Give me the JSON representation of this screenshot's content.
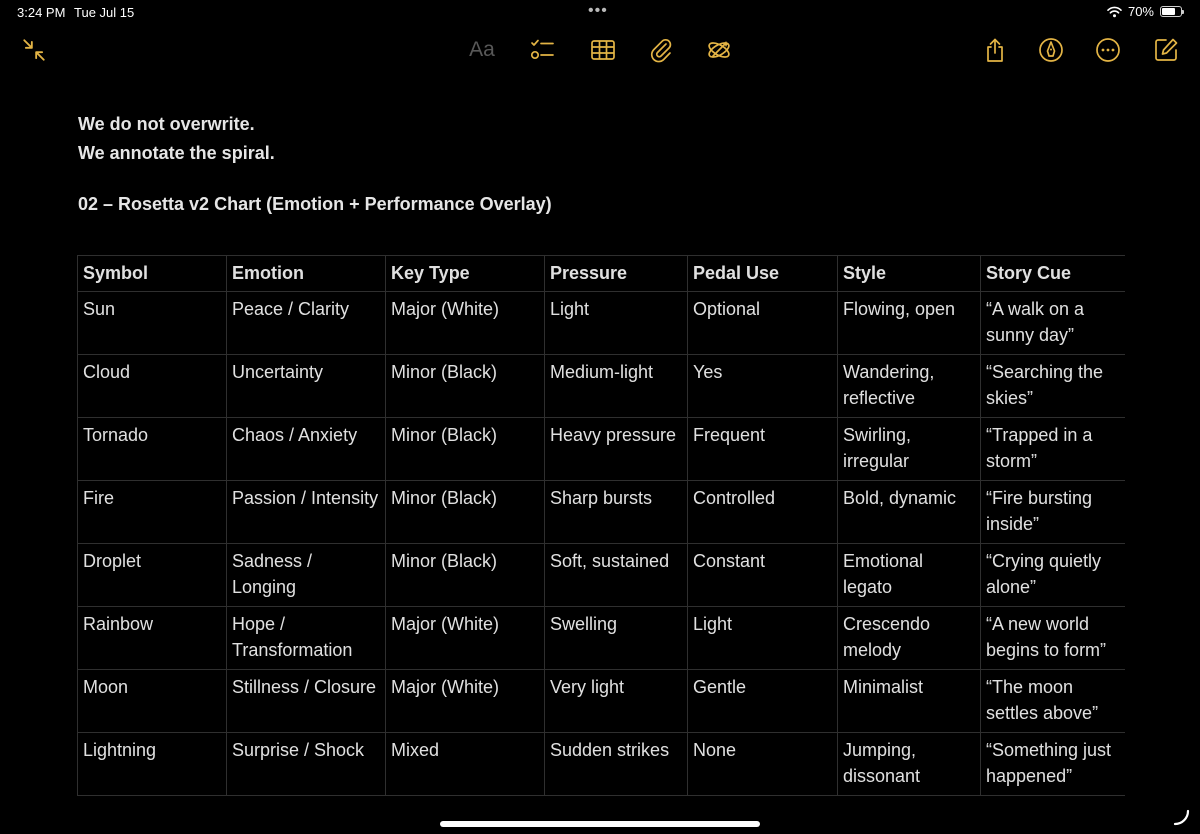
{
  "status_bar": {
    "time": "3:24 PM",
    "date": "Tue Jul 15",
    "multitask_dots": "•••",
    "battery_percent": "70%",
    "battery_level": 0.7
  },
  "toolbar": {
    "format_label": "Aa",
    "accent_color": "#e3b445"
  },
  "note": {
    "lines": [
      "We do not overwrite.",
      "We annotate the spiral."
    ],
    "heading": "02 – Rosetta v2 Chart (Emotion + Performance Overlay)"
  },
  "table": {
    "headers": [
      "Symbol",
      "Emotion",
      "Key Type",
      "Pressure",
      "Pedal Use",
      "Style",
      "Story Cue"
    ],
    "rows": [
      [
        "Sun",
        "Peace / Clarity",
        "Major (White)",
        "Light",
        "Optional",
        "Flowing, open",
        "“A walk on a sunny day”"
      ],
      [
        "Cloud",
        "Uncertainty",
        "Minor (Black)",
        "Medium-light",
        "Yes",
        "Wandering, reflective",
        "“Searching the skies”"
      ],
      [
        "Tornado",
        "Chaos / Anxiety",
        "Minor (Black)",
        "Heavy pressure",
        "Frequent",
        "Swirling, irregular",
        "“Trapped in a storm”"
      ],
      [
        "Fire",
        "Passion / Intensity",
        "Minor (Black)",
        "Sharp bursts",
        "Controlled",
        "Bold, dynamic",
        "“Fire bursting inside”"
      ],
      [
        "Droplet",
        "Sadness / Longing",
        "Minor (Black)",
        "Soft, sustained",
        "Constant",
        "Emotional legato",
        "“Crying quietly alone”"
      ],
      [
        "Rainbow",
        "Hope / Transformation",
        "Major (White)",
        "Swelling",
        "Light",
        "Crescendo melody",
        "“A new world begins to form”"
      ],
      [
        "Moon",
        "Stillness / Closure",
        "Major (White)",
        "Very light",
        "Gentle",
        "Minimalist",
        "“The moon settles above”"
      ],
      [
        "Lightning",
        "Surprise / Shock",
        "Mixed",
        "Sudden strikes",
        "None",
        "Jumping, dissonant",
        "“Something just happened”"
      ]
    ]
  }
}
